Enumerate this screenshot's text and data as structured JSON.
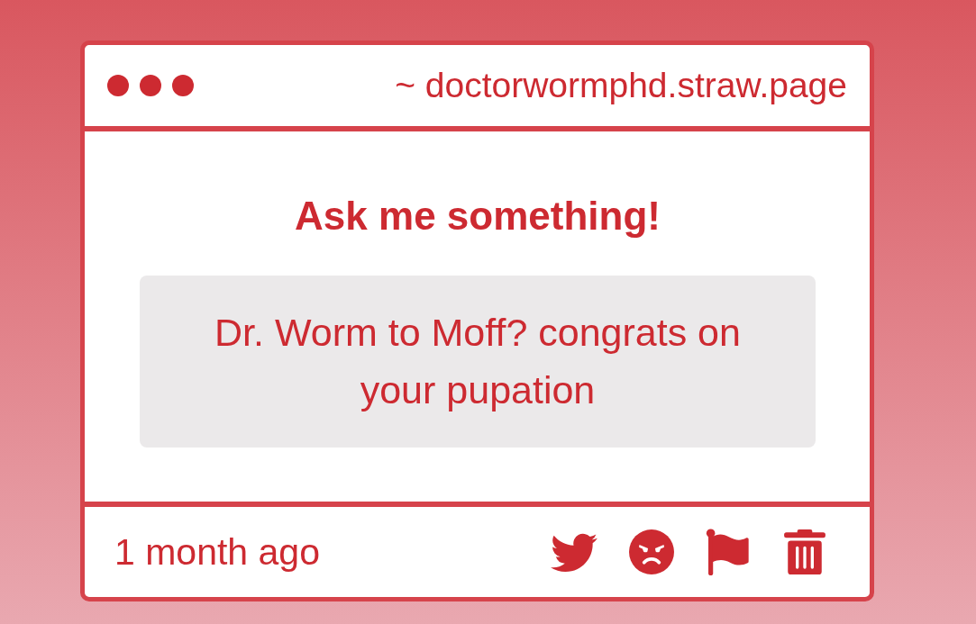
{
  "window": {
    "address": "~ doctorwormphd.straw.page"
  },
  "heading": "Ask me something!",
  "question": "Dr. Worm to Moff? congrats on your pupation",
  "footer": {
    "time": "1 month ago",
    "actions": [
      {
        "kind": "bird"
      },
      {
        "kind": "angry"
      },
      {
        "kind": "flag"
      },
      {
        "kind": "trash"
      }
    ]
  }
}
